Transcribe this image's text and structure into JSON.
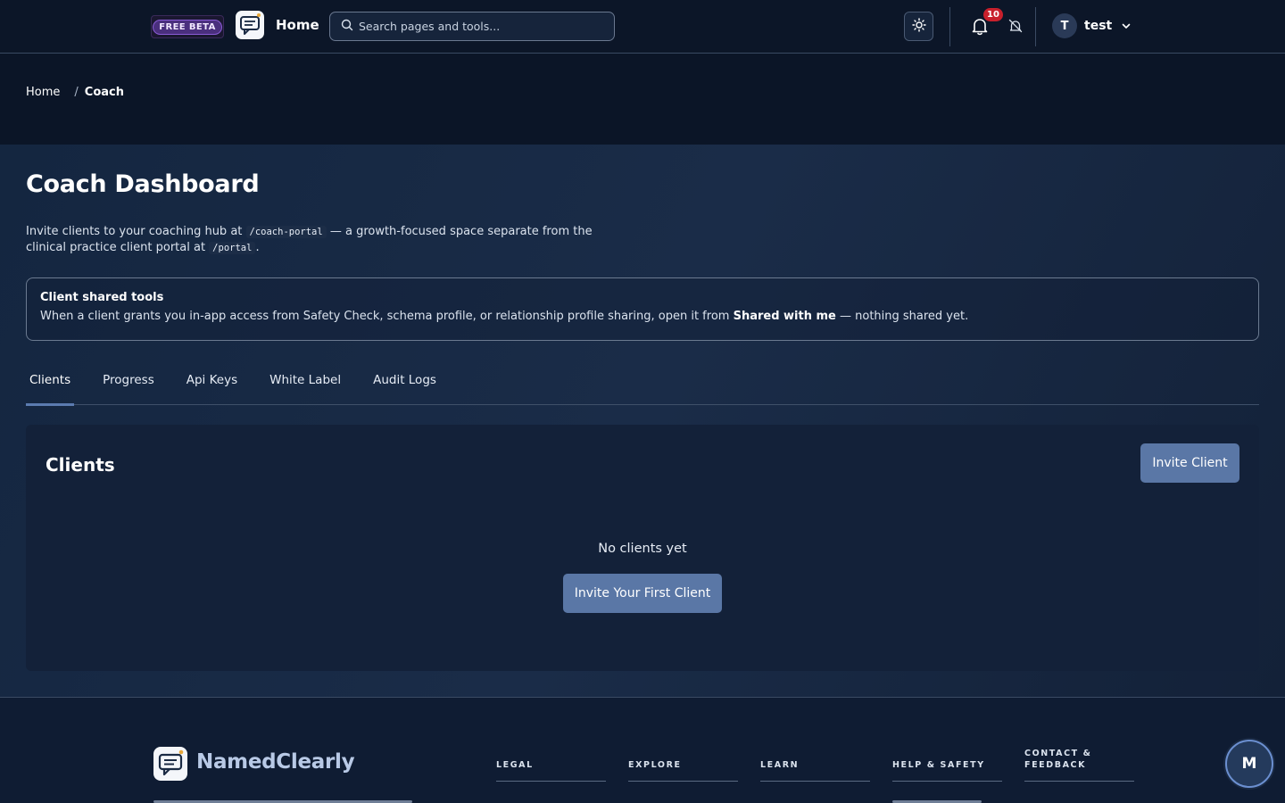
{
  "header": {
    "beta_badge": "FREE BETA",
    "home_label": "Home",
    "search_placeholder": "Search pages and tools...",
    "notification_count": "10",
    "user_initial": "T",
    "user_name": "test"
  },
  "breadcrumb": {
    "home": "Home",
    "separator": "/",
    "current": "Coach"
  },
  "page": {
    "title": "Coach Dashboard",
    "intro_before": "Invite clients to your coaching hub at ",
    "intro_code1": "/coach-portal",
    "intro_middle": " — a growth-focused space separate from the clinical practice client portal at ",
    "intro_code2": "/portal",
    "intro_after": "."
  },
  "shared_tools": {
    "title": "Client shared tools",
    "text_before": "When a client grants you in-app access from Safety Check, schema profile, or relationship profile sharing, open it from ",
    "text_bold": "Shared with me",
    "text_after": " — nothing shared yet."
  },
  "tabs": [
    {
      "label": "Clients",
      "active": true
    },
    {
      "label": "Progress",
      "active": false
    },
    {
      "label": "Api Keys",
      "active": false
    },
    {
      "label": "White Label",
      "active": false
    },
    {
      "label": "Audit Logs",
      "active": false
    }
  ],
  "clients": {
    "title": "Clients",
    "invite_button": "Invite Client",
    "empty_text": "No clients yet",
    "invite_first_button": "Invite Your First Client"
  },
  "footer": {
    "brand": "NamedClearly",
    "columns": [
      "LEGAL",
      "EXPLORE",
      "LEARN",
      "HELP & SAFETY",
      "CONTACT & FEEDBACK"
    ]
  },
  "chat_fab_label": "M",
  "colors": {
    "background": "#0f1c33",
    "header": "#0c1628",
    "primary_button": "#5a77a6",
    "badge_purple": "#4a2f7d",
    "notification_red": "#c8202c"
  },
  "icons": [
    "logo-icon",
    "search-icon",
    "sun-icon",
    "bell-icon",
    "bell-off-icon",
    "chevron-down-icon"
  ]
}
